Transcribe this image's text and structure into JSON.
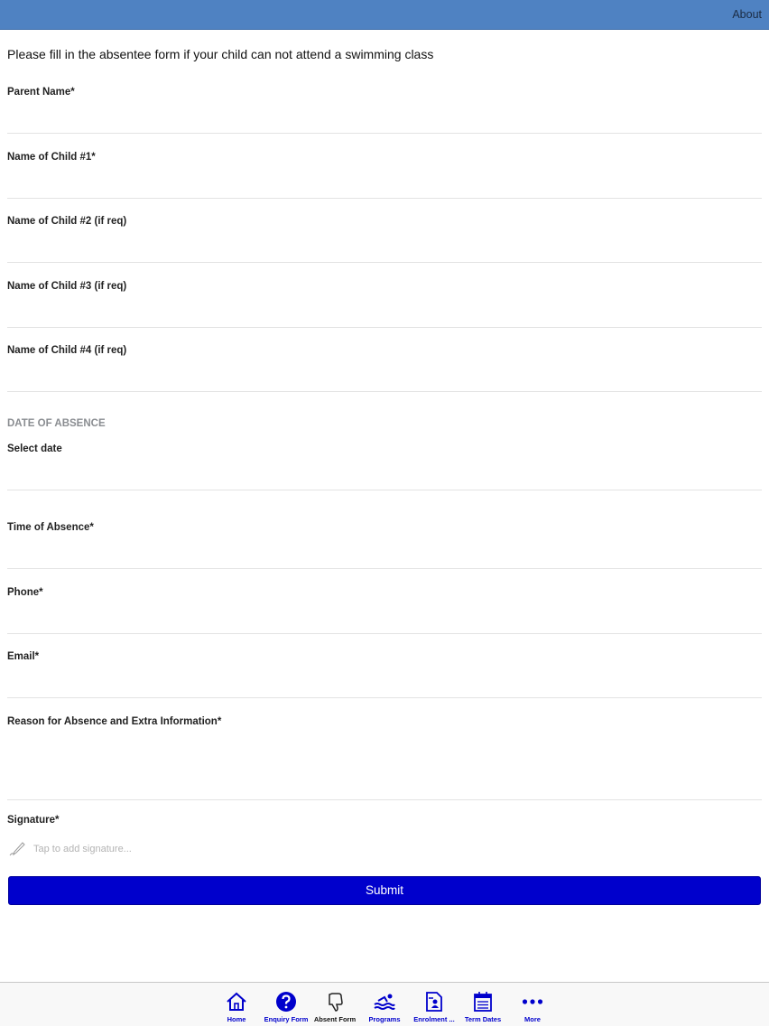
{
  "header": {
    "about_label": "About"
  },
  "form": {
    "intro": "Please fill in the absentee form if your child can not attend a swimming class",
    "parent_name_label": "Parent Name*",
    "child1_label": "Name of Child #1*",
    "child2_label": "Name of Child #2 (if req)",
    "child3_label": "Name of Child #3 (if req)",
    "child4_label": "Name of Child #4 (if req)",
    "date_section": "DATE OF ABSENCE",
    "select_date_label": "Select date",
    "time_label": "Time of Absence*",
    "phone_label": "Phone*",
    "email_label": "Email*",
    "reason_label": "Reason for Absence and Extra Information*",
    "signature_label": "Signature*",
    "signature_placeholder": "Tap to add signature...",
    "submit_label": "Submit"
  },
  "tabs": [
    {
      "label": "Home",
      "icon": "home-icon"
    },
    {
      "label": "Enquiry Form",
      "icon": "question-icon"
    },
    {
      "label": "Absent Form",
      "icon": "thumbs-down-icon"
    },
    {
      "label": "Programs",
      "icon": "swimmer-icon"
    },
    {
      "label": "Enrolment ...",
      "icon": "document-user-icon"
    },
    {
      "label": "Term Dates",
      "icon": "calendar-icon"
    },
    {
      "label": "More",
      "icon": "more-icon"
    }
  ],
  "colors": {
    "header": "#4f82c2",
    "accent": "#0000cc"
  }
}
